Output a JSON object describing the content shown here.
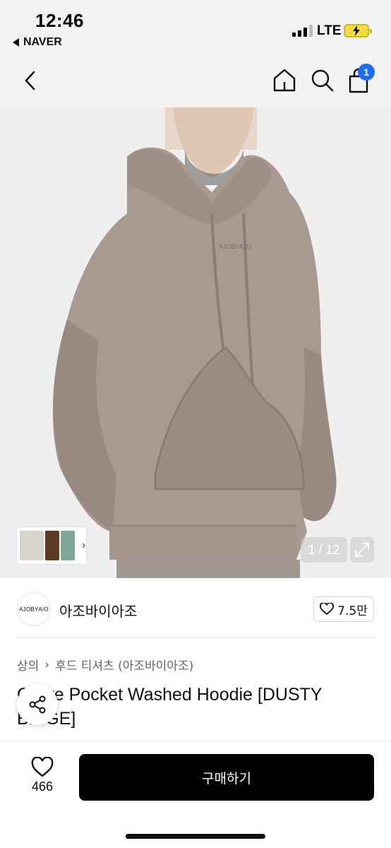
{
  "status_bar": {
    "time": "12:46",
    "back_app": "NAVER",
    "network": "LTE"
  },
  "nav": {
    "cart_count": "1",
    "icons": [
      "chevron-left-icon",
      "home-icon",
      "search-icon",
      "shopping-bag-icon"
    ]
  },
  "gallery": {
    "page_counter": "1 / 12",
    "thumb_colors": [
      "#d9d4cc",
      "#5a3a25",
      "#7fa89a"
    ]
  },
  "brand": {
    "logo_text": "AJOBYA/O",
    "name": "아조바이아조",
    "likes": "7.5만"
  },
  "breadcrumb": {
    "category": "상의",
    "subcategory": "후드 티셔츠 (아조바이아조)"
  },
  "product": {
    "title": "Curve Pocket Washed Hoodie [DUSTY BEIGE]"
  },
  "bottom_bar": {
    "wish_count": "466",
    "buy_label": "구매하기"
  },
  "colors": {
    "accent_badge": "#1e6bf5",
    "buy_button": "#000000",
    "hoodie": "#a8998f"
  }
}
